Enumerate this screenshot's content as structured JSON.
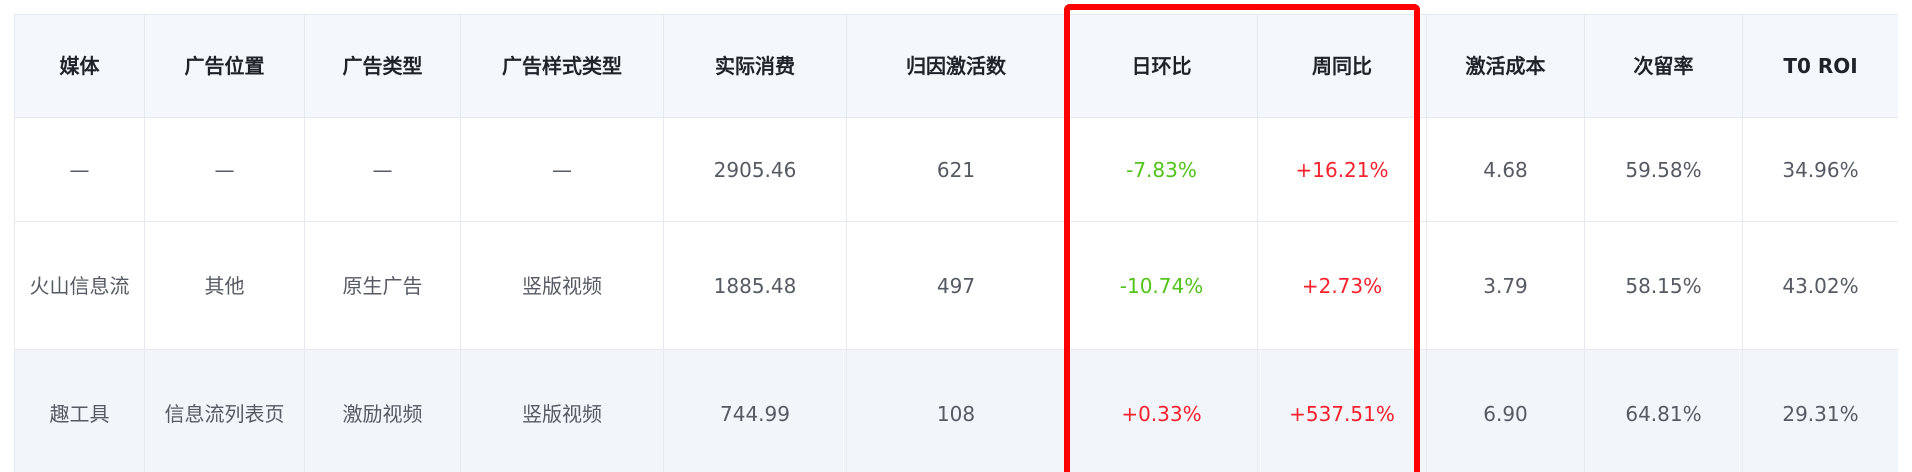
{
  "table": {
    "headers": [
      "媒体",
      "广告位置",
      "广告类型",
      "广告样式类型",
      "实际消费",
      "归因激活数",
      "日环比",
      "周同比",
      "激活成本",
      "次留率",
      "T0 ROI"
    ],
    "rows": [
      {
        "media": "—",
        "position": "—",
        "ad_type": "—",
        "style_type": "—",
        "spend": "2905.46",
        "activations": "621",
        "day_over_day": "-7.83%",
        "week_over_week": "+16.21%",
        "activation_cost": "4.68",
        "retention": "59.58%",
        "t0_roi": "34.96%"
      },
      {
        "media": "火山信息流",
        "position": "其他",
        "ad_type": "原生广告",
        "style_type": "竖版视频",
        "spend": "1885.48",
        "activations": "497",
        "day_over_day": "-10.74%",
        "week_over_week": "+2.73%",
        "activation_cost": "3.79",
        "retention": "58.15%",
        "t0_roi": "43.02%"
      },
      {
        "media": "趣工具",
        "position": "信息流列表页",
        "ad_type": "激励视频",
        "style_type": "竖版视频",
        "spend": "744.99",
        "activations": "108",
        "day_over_day": "+0.33%",
        "week_over_week": "+537.51%",
        "activation_cost": "6.90",
        "retention": "64.81%",
        "t0_roi": "29.31%"
      }
    ]
  },
  "colors": {
    "increase": "#f5222d",
    "decrease": "#52c41a",
    "highlight_border": "#ff0000",
    "header_bg": "#f4f7fb"
  }
}
